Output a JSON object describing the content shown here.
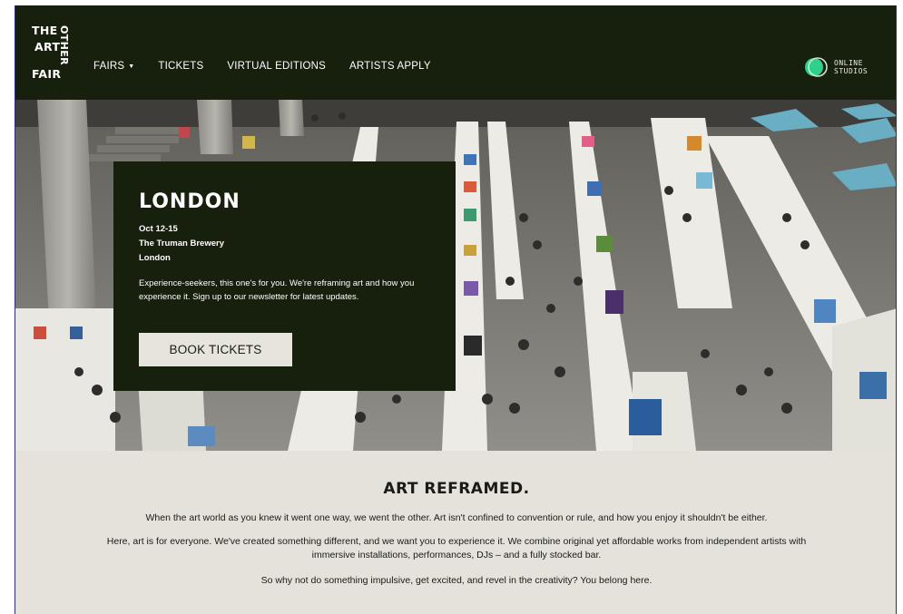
{
  "brand": {
    "word_the": "THE",
    "word_other": "OTHER",
    "word_art": "ART",
    "word_fair": "FAIR"
  },
  "nav": {
    "items": [
      {
        "label": "FAIRS",
        "has_dropdown": true
      },
      {
        "label": "TICKETS"
      },
      {
        "label": "VIRTUAL EDITIONS"
      },
      {
        "label": "ARTISTS APPLY"
      }
    ],
    "online_studios": {
      "line1": "ONLINE",
      "line2": "STUDIOS"
    }
  },
  "hero": {
    "city": "LONDON",
    "dates": "Oct 12-15",
    "venue": "The Truman Brewery",
    "location": "London",
    "description": "Experience-seekers, this one's for you. We're reframing art and how you experience it. Sign up to our newsletter for latest updates.",
    "cta_label": "BOOK TICKETS"
  },
  "about": {
    "title": "ART REFRAMED.",
    "paragraphs": [
      "When the art world as you knew it went one way, we went the other. Art isn't confined to convention or rule, and how you enjoy it shouldn't be either.",
      "Here, art is for everyone. We've created something different, and we want you to experience it. We combine original yet affordable works from independent artists with immersive installations, performances, DJs – and a fully stocked bar.",
      "So why not do something impulsive, get excited, and revel in the creativity? You belong here."
    ]
  },
  "colors": {
    "dark_green": "#171f0d",
    "cream": "#e4e2da",
    "button": "#e6e4dc",
    "online_accent": "#2fd18a"
  }
}
